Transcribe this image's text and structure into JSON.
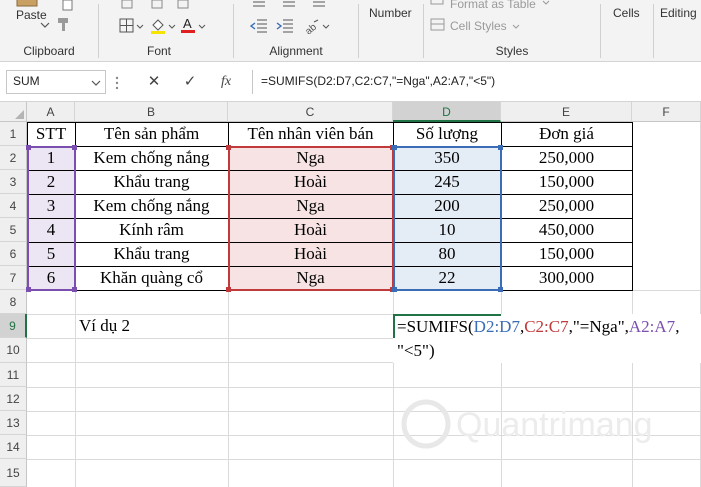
{
  "ribbon": {
    "clipboard": {
      "paste_label": "Paste",
      "group_label": "Clipboard"
    },
    "font": {
      "group_label": "Font"
    },
    "alignment": {
      "group_label": "Alignment"
    },
    "number": {
      "label": "Number"
    },
    "styles": {
      "format_as_table": "Format as Table",
      "cell_styles": "Cell Styles",
      "group_label": "Styles"
    },
    "cells": {
      "label": "Cells"
    },
    "editing": {
      "label": "Editing"
    }
  },
  "formula_bar": {
    "name_box": "SUM",
    "cancel_icon": "✕",
    "enter_icon": "✓",
    "fx_label": "fx",
    "formula": "=SUMIFS(D2:D7,C2:C7,\"=Nga\",A2:A7,\"<5\")"
  },
  "columns": [
    "A",
    "B",
    "C",
    "D",
    "E",
    "F"
  ],
  "rows": [
    "1",
    "2",
    "3",
    "4",
    "5",
    "6",
    "7",
    "8",
    "9",
    "10",
    "11",
    "12",
    "13",
    "14",
    "15"
  ],
  "table": {
    "headers": [
      "STT",
      "Tên sản phẩm",
      "Tên nhân viên bán",
      "Số lượng",
      "Đơn giá"
    ],
    "rows": [
      [
        "1",
        "Kem chống nắng",
        "Nga",
        "350",
        "250,000"
      ],
      [
        "2",
        "Khẩu trang",
        "Hoài",
        "245",
        "150,000"
      ],
      [
        "3",
        "Kem chống nắng",
        "Nga",
        "200",
        "250,000"
      ],
      [
        "4",
        "Kính râm",
        "Hoài",
        "10",
        "450,000"
      ],
      [
        "5",
        "Khẩu trang",
        "Hoài",
        "80",
        "150,000"
      ],
      [
        "6",
        "Khăn quàng cổ",
        "Nga",
        "22",
        "300,000"
      ]
    ]
  },
  "example_label": "Ví dụ 2",
  "editing_formula": {
    "prefix": "=SUMIFS(",
    "ref_d": "D2:D7",
    "comma1": ",",
    "ref_c": "C2:C7",
    "crit1": ",\"=Nga\",",
    "ref_a": "A2:A7",
    "comma2": ",",
    "line2": "\"<5\")"
  },
  "colors": {
    "accent": "#217346",
    "range_a": "#7a4fb0",
    "range_c": "#c0393b",
    "range_d": "#3a6db5"
  },
  "watermark": "Quantrimang"
}
